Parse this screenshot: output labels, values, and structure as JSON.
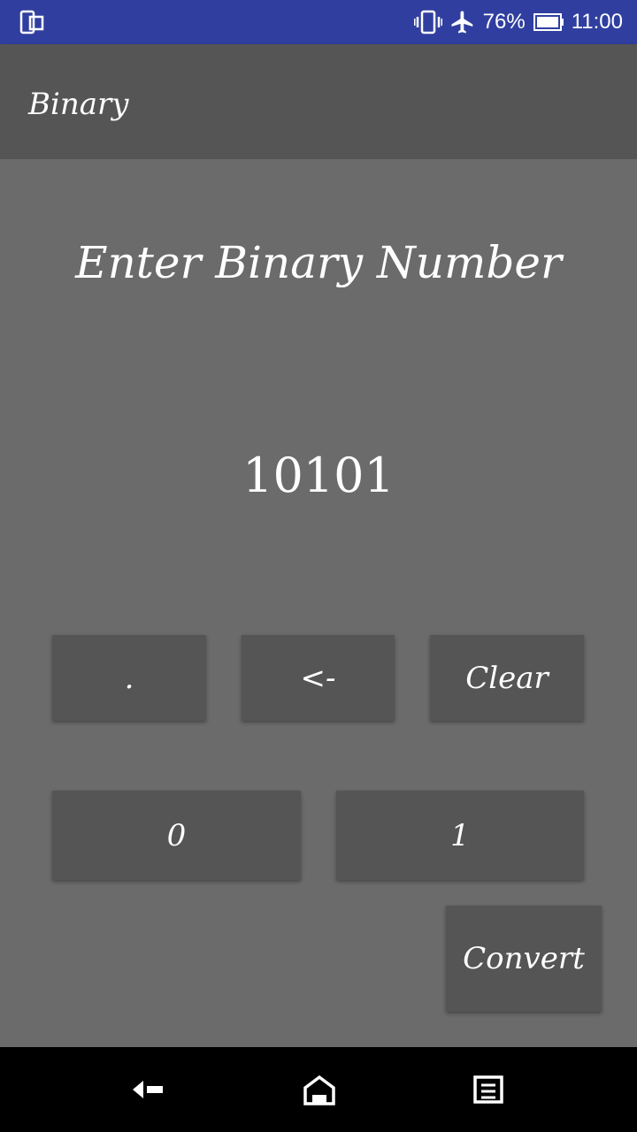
{
  "status_bar": {
    "battery_percent": "76%",
    "time": "11:00",
    "icons": [
      "screen-mirror-icon",
      "vibrate-icon",
      "airplane-icon",
      "battery-icon"
    ]
  },
  "app_bar": {
    "title": "Binary"
  },
  "main": {
    "prompt": "Enter Binary Number",
    "display_value": "10101"
  },
  "keypad": {
    "dot": ".",
    "backspace": "<-",
    "clear": "Clear",
    "zero": "0",
    "one": "1",
    "convert": "Convert"
  },
  "nav_bar": {
    "icons": [
      "back-icon",
      "home-icon",
      "recents-icon"
    ]
  },
  "colors": {
    "status_bar": "#303f9f",
    "app_bar": "#555555",
    "background": "#6b6b6b",
    "button": "#555555",
    "nav_bar": "#000000",
    "text": "#ffffff"
  }
}
